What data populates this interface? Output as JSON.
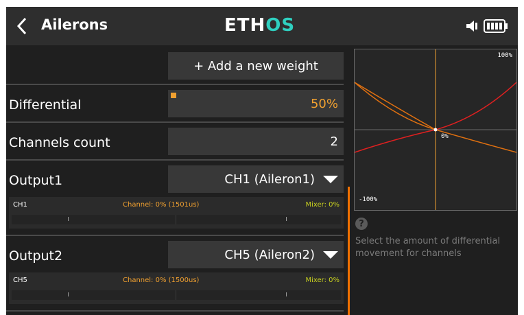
{
  "header": {
    "title": "Ailerons",
    "logo_part1": "ETH",
    "logo_part2": "OS"
  },
  "add_weight_label": "+ Add a new weight",
  "differential": {
    "label": "Differential",
    "value": "50%"
  },
  "channels_count": {
    "label": "Channels count",
    "value": "2"
  },
  "outputs": [
    {
      "label": "Output1",
      "selected": "CH1 (Aileron1)",
      "monitor": {
        "ch": "CH1",
        "channel": "Channel: 0% (1501us)",
        "mixer": "Mixer: 0%"
      }
    },
    {
      "label": "Output2",
      "selected": "CH5 (Aileron2)",
      "monitor": {
        "ch": "CH5",
        "channel": "Channel: 0% (1500us)",
        "mixer": "Mixer: 0%"
      }
    }
  ],
  "graph": {
    "top_label": "100%",
    "center_label": "0%",
    "bottom_label": "-100%"
  },
  "help": {
    "icon": "question-icon",
    "text": "Select the amount of differential movement for channels"
  },
  "colors": {
    "accent_orange": "#f0a030",
    "curve_red": "#e02020",
    "curve_orange": "#e07010",
    "mixer_green": "#c8d020",
    "logo_teal": "#2fd0c0"
  }
}
